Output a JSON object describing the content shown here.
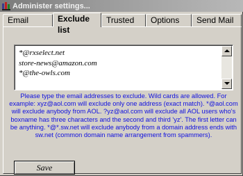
{
  "window": {
    "title": "Administer settings..."
  },
  "tabs": [
    {
      "label": "Email boxes",
      "active": false
    },
    {
      "label": "Exclude list",
      "active": true
    },
    {
      "label": "Trusted list",
      "active": false
    },
    {
      "label": "Options",
      "active": false
    },
    {
      "label": "Send Mail",
      "active": false
    }
  ],
  "exclude_list": {
    "items": [
      "*@rxselect.net",
      "store-news@amazon.com",
      "*@the-owls.com"
    ]
  },
  "help_text": "Please type the email addresses to exclude. Wild cards are allowed. For example: xyz@aol.com will exclude only one address (exact match). *@aol.com will exclude anybody from AOL. ?yz@aol.com will exclude all AOL users who's boxname has three characters and the second and third 'yz'. The first letter can be anything. *@*.sw.net will exclude anybody from a domain address ends with sw.net (common domain name arrangement from spammers).",
  "buttons": {
    "save": "Save"
  },
  "colors": {
    "help_text": "#1010e0",
    "titlebar_start": "#7a7a7a",
    "face": "#d4d0c8"
  },
  "icons": {
    "app": "app-icon",
    "scroll_up": "arrow-up-icon",
    "scroll_down": "arrow-down-icon"
  }
}
